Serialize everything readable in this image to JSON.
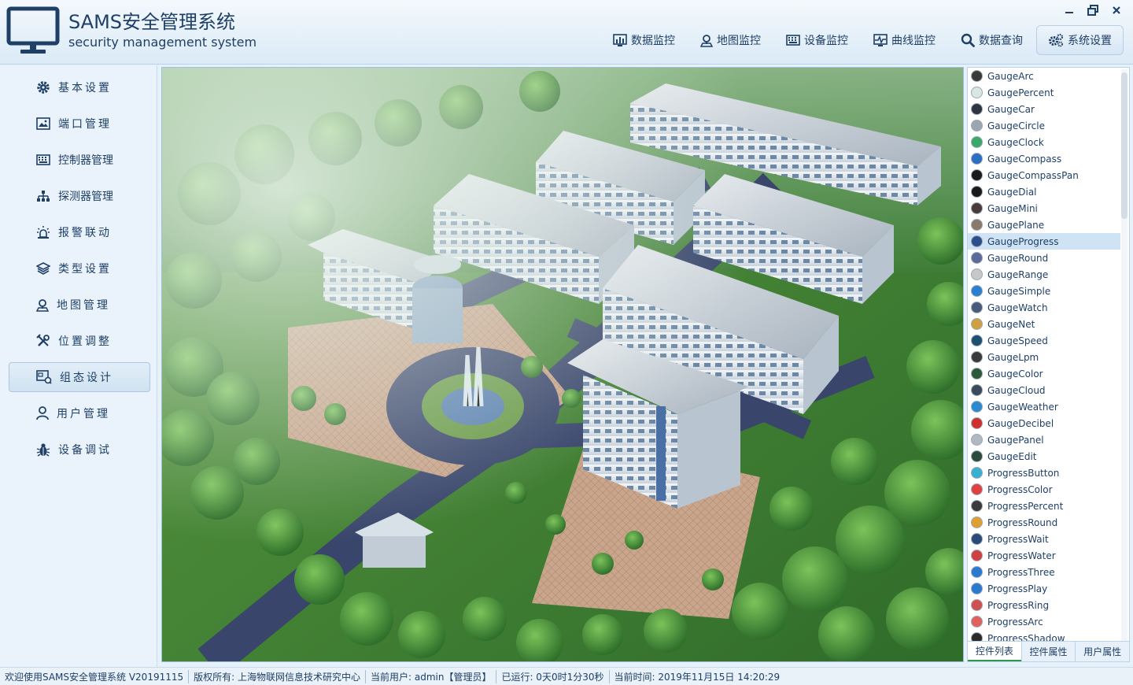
{
  "app": {
    "title": "SAMS安全管理系统",
    "subtitle": "security management system",
    "accent_color": "#1e3f66"
  },
  "window_controls": [
    {
      "name": "minimize",
      "icon": "minimize-icon"
    },
    {
      "name": "restore",
      "icon": "restore-icon"
    },
    {
      "name": "close",
      "icon": "close-icon"
    }
  ],
  "topnav": [
    {
      "label": "数据监控",
      "icon": "bar-chart-icon"
    },
    {
      "label": "地图监控",
      "icon": "map-pin-icon"
    },
    {
      "label": "设备监控",
      "icon": "keyboard-icon"
    },
    {
      "label": "曲线监控",
      "icon": "pulse-icon"
    },
    {
      "label": "数据查询",
      "icon": "search-icon"
    },
    {
      "label": "系统设置",
      "icon": "gears-icon",
      "active": true
    }
  ],
  "sidebar": [
    {
      "label": "基本设置",
      "icon": "gear-icon"
    },
    {
      "label": "端口管理",
      "icon": "image-icon"
    },
    {
      "label": "控制器管理",
      "icon": "keyboard-icon"
    },
    {
      "label": "探测器管理",
      "icon": "sitemap-icon"
    },
    {
      "label": "报警联动",
      "icon": "alarm-icon"
    },
    {
      "label": "类型设置",
      "icon": "layers-icon"
    },
    {
      "label": "地图管理",
      "icon": "map-pin-icon"
    },
    {
      "label": "位置调整",
      "icon": "tools-icon"
    },
    {
      "label": "组态设计",
      "icon": "designer-icon",
      "active": true
    },
    {
      "label": "用户管理",
      "icon": "user-icon"
    },
    {
      "label": "设备调试",
      "icon": "bug-icon"
    }
  ],
  "main_view": {
    "image_name": "industrial-park-aerial-map"
  },
  "controls": {
    "items": [
      {
        "label": "GaugeArc",
        "color": "#3a3a3a"
      },
      {
        "label": "GaugePercent",
        "color": "#d8e8e0"
      },
      {
        "label": "GaugeCar",
        "color": "#2e3440"
      },
      {
        "label": "GaugeCircle",
        "color": "#9aa6b2"
      },
      {
        "label": "GaugeClock",
        "color": "#3aa86b"
      },
      {
        "label": "GaugeCompass",
        "color": "#2a6fc4"
      },
      {
        "label": "GaugeCompassPan",
        "color": "#1a1a1a"
      },
      {
        "label": "GaugeDial",
        "color": "#1a1a1a"
      },
      {
        "label": "GaugeMini",
        "color": "#4a3a3a"
      },
      {
        "label": "GaugePlane",
        "color": "#8a7a6a"
      },
      {
        "label": "GaugeProgress",
        "color": "#2b4f8a",
        "selected": true
      },
      {
        "label": "GaugeRound",
        "color": "#5a6a9a"
      },
      {
        "label": "GaugeRange",
        "color": "#c8c8c8"
      },
      {
        "label": "GaugeSimple",
        "color": "#2a7fd0"
      },
      {
        "label": "GaugeWatch",
        "color": "#4a5a7a"
      },
      {
        "label": "GaugeNet",
        "color": "#d0a040"
      },
      {
        "label": "GaugeSpeed",
        "color": "#1f4f6f"
      },
      {
        "label": "GaugeLpm",
        "color": "#3a3a3a"
      },
      {
        "label": "GaugeColor",
        "color": "#2a5a3a"
      },
      {
        "label": "GaugeCloud",
        "color": "#3a4a5a"
      },
      {
        "label": "GaugeWeather",
        "color": "#2a8ad0"
      },
      {
        "label": "GaugeDecibel",
        "color": "#d03030"
      },
      {
        "label": "GaugePanel",
        "color": "#b0b8c0"
      },
      {
        "label": "GaugeEdit",
        "color": "#2a4a3a"
      },
      {
        "label": "ProgressButton",
        "color": "#3ab0d0"
      },
      {
        "label": "ProgressColor",
        "color": "#e04040"
      },
      {
        "label": "ProgressPercent",
        "color": "#3a3a3a"
      },
      {
        "label": "ProgressRound",
        "color": "#e0a030"
      },
      {
        "label": "ProgressWait",
        "color": "#2a4a7a"
      },
      {
        "label": "ProgressWater",
        "color": "#d04040"
      },
      {
        "label": "ProgressThree",
        "color": "#2a7ad0"
      },
      {
        "label": "ProgressPlay",
        "color": "#2a7ad0"
      },
      {
        "label": "ProgressRing",
        "color": "#d05050"
      },
      {
        "label": "ProgressArc",
        "color": "#e06060"
      },
      {
        "label": "ProgressShadow",
        "color": "#2a2a2a"
      }
    ]
  },
  "panel_tabs": [
    {
      "label": "控件列表",
      "active": true
    },
    {
      "label": "控件属性"
    },
    {
      "label": "用户属性"
    }
  ],
  "statusbar": {
    "welcome": "欢迎使用SAMS安全管理系统 V20191115",
    "copyright": "版权所有: 上海物联网信息技术研究中心",
    "current_user": "当前用户: admin【管理员】",
    "uptime": "已运行: 0天0时1分30秒",
    "current_time": "当前时间: 2019年11月15日 14:20:29"
  }
}
